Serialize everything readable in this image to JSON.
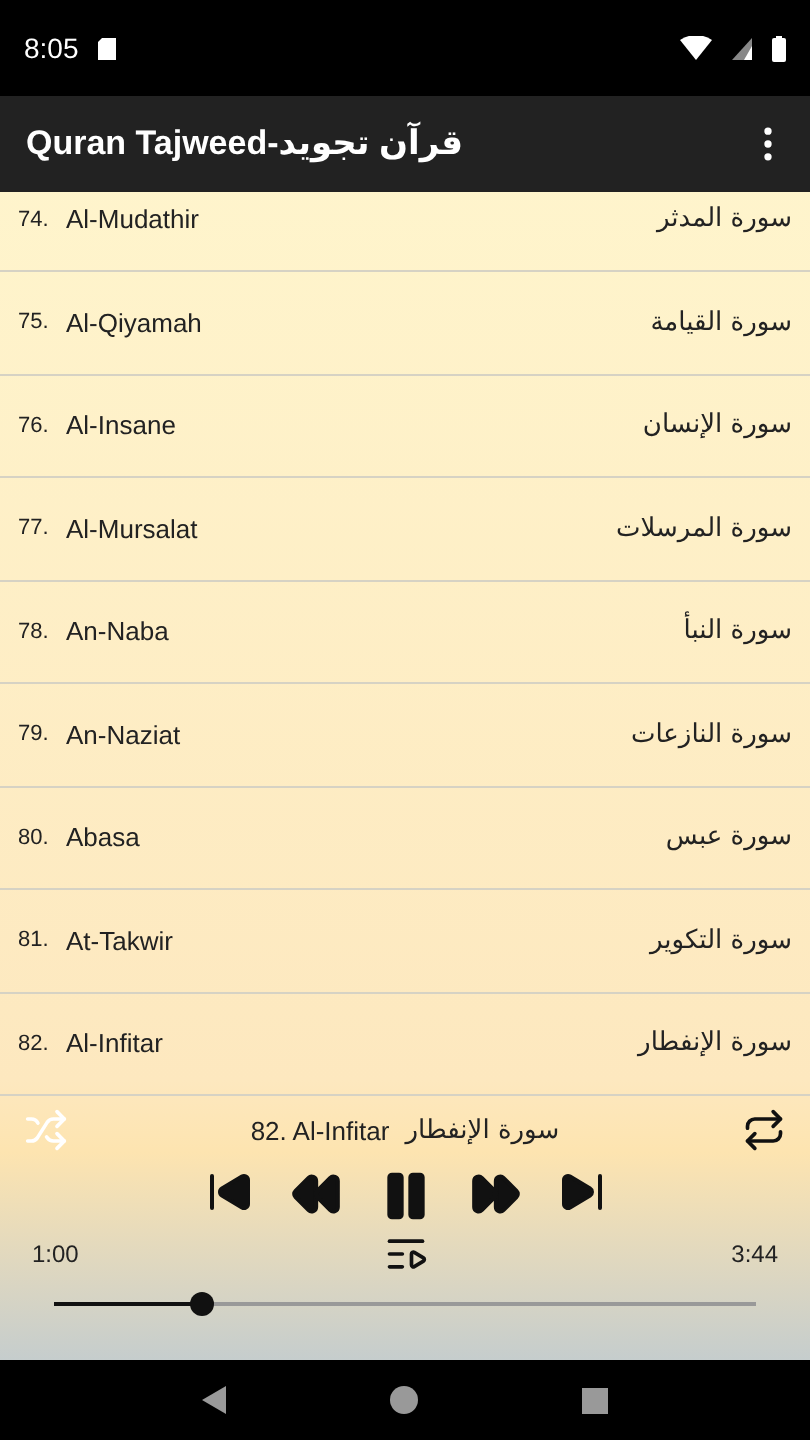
{
  "status_bar": {
    "time": "8:05"
  },
  "app_bar": {
    "title": "Quran Tajweed-قرآن تجويد"
  },
  "surahs": [
    {
      "number": "74.",
      "name": "Al-Mudathir",
      "arabic": "سورة المدثر"
    },
    {
      "number": "75.",
      "name": "Al-Qiyamah",
      "arabic": "سورة القيامة"
    },
    {
      "number": "76.",
      "name": "Al-Insane",
      "arabic": "سورة الإنسان"
    },
    {
      "number": "77.",
      "name": "Al-Mursalat",
      "arabic": "سورة المرسلات"
    },
    {
      "number": "78.",
      "name": "An-Naba",
      "arabic": "سورة النبأ"
    },
    {
      "number": "79.",
      "name": "An-Naziat",
      "arabic": "سورة النازعات"
    },
    {
      "number": "80.",
      "name": "Abasa",
      "arabic": "سورة عبس"
    },
    {
      "number": "81.",
      "name": "At-Takwir",
      "arabic": "سورة التكوير"
    },
    {
      "number": "82.",
      "name": "Al-Infitar",
      "arabic": "سورة الإنفطار"
    }
  ],
  "player": {
    "track": "82. Al-Infitar",
    "track_arabic": "سورة الإنفطار",
    "shuffle": {
      "on": false
    },
    "repeat": {
      "on": true
    },
    "elapsed": "1:00",
    "duration": "3:44",
    "level": 0.21,
    "playing": true
  }
}
